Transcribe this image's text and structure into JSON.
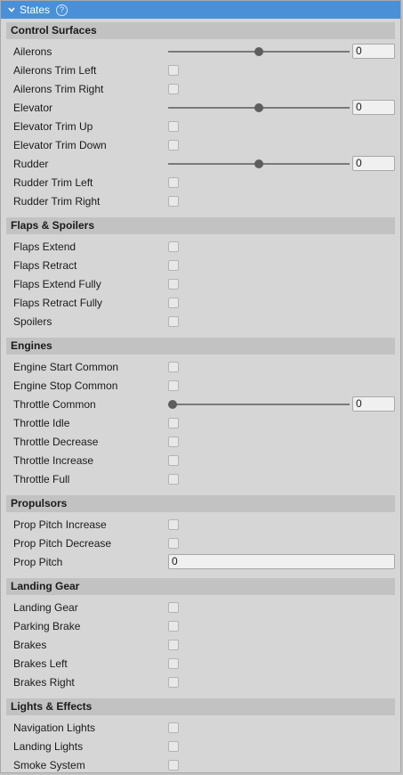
{
  "header": {
    "title": "States",
    "help": "?"
  },
  "sections": {
    "control": {
      "title": "Control Surfaces",
      "ailerons": {
        "label": "Ailerons",
        "value": "0",
        "level": 0.5
      },
      "ailerons_trim_left": "Ailerons Trim Left",
      "ailerons_trim_right": "Ailerons Trim Right",
      "elevator": {
        "label": "Elevator",
        "value": "0",
        "level": 0.5
      },
      "elevator_trim_up": "Elevator Trim Up",
      "elevator_trim_down": "Elevator Trim Down",
      "rudder": {
        "label": "Rudder",
        "value": "0",
        "level": 0.5
      },
      "rudder_trim_left": "Rudder Trim Left",
      "rudder_trim_right": "Rudder Trim Right"
    },
    "flaps": {
      "title": "Flaps & Spoilers",
      "flaps_extend": "Flaps Extend",
      "flaps_retract": "Flaps Retract",
      "flaps_extend_fully": "Flaps Extend Fully",
      "flaps_retract_fully": "Flaps Retract Fully",
      "spoilers": "Spoilers"
    },
    "engines": {
      "title": "Engines",
      "engine_start_common": "Engine Start Common",
      "engine_stop_common": "Engine Stop Common",
      "throttle_common": {
        "label": "Throttle Common",
        "value": "0",
        "level": 0.0
      },
      "throttle_idle": "Throttle Idle",
      "throttle_decrease": "Throttle Decrease",
      "throttle_increase": "Throttle Increase",
      "throttle_full": "Throttle Full"
    },
    "propulsors": {
      "title": "Propulsors",
      "prop_pitch_increase": "Prop Pitch Increase",
      "prop_pitch_decrease": "Prop Pitch Decrease",
      "prop_pitch": {
        "label": "Prop Pitch",
        "value": "0"
      }
    },
    "landing": {
      "title": "Landing Gear",
      "landing_gear": "Landing Gear",
      "parking_brake": "Parking Brake",
      "brakes": "Brakes",
      "brakes_left": "Brakes Left",
      "brakes_right": "Brakes Right"
    },
    "lights": {
      "title": "Lights & Effects",
      "navigation_lights": "Navigation Lights",
      "landing_lights": "Landing Lights",
      "smoke_system": "Smoke System"
    }
  },
  "colors": {
    "header_bg": "#4a90d9",
    "section_bg": "#c2c2c2",
    "panel_bg": "#d6d6d6"
  }
}
